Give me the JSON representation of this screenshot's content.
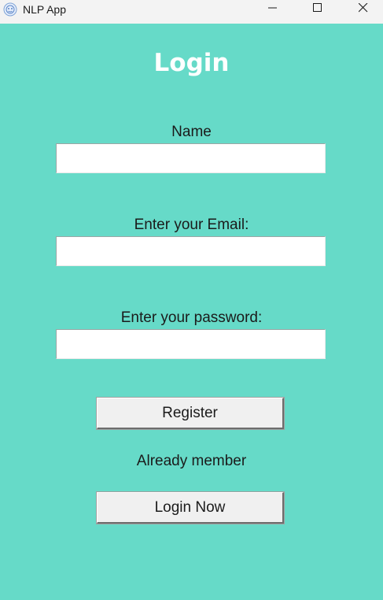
{
  "window": {
    "title": "NLP App",
    "icon": "nlp-app-icon",
    "controls": {
      "minimize_icon": "minimize-icon",
      "maximize_icon": "maximize-icon",
      "close_icon": "close-icon"
    }
  },
  "form": {
    "heading": "Login",
    "name_label": "Name",
    "name_value": "",
    "email_label": "Enter your Email:",
    "email_value": "",
    "password_label": "Enter your password:",
    "password_value": "",
    "register_label": "Register",
    "already_member_text": "Already member",
    "login_now_label": "Login Now"
  },
  "colors": {
    "background": "#66dac8",
    "heading_text": "#ffffff",
    "button_bg": "#f0f0f0",
    "titlebar_bg": "#f3f3f3"
  }
}
